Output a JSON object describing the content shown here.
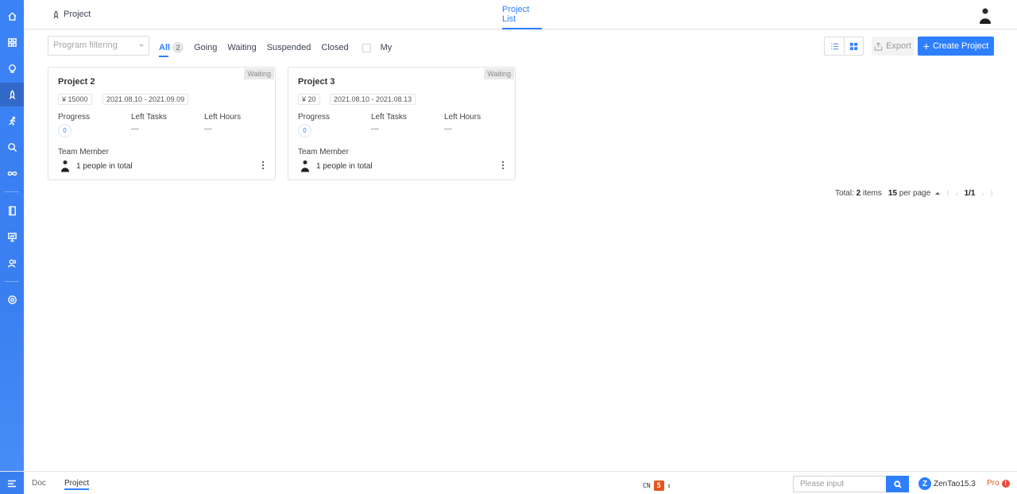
{
  "header": {
    "app_name": "Project",
    "active_tab": "Project List"
  },
  "toolbar": {
    "filter_placeholder": "Program filtering",
    "tabs": [
      {
        "label": "All",
        "count": "2"
      },
      {
        "label": "Going"
      },
      {
        "label": "Waiting"
      },
      {
        "label": "Suspended"
      },
      {
        "label": "Closed"
      }
    ],
    "my_label": "My",
    "export_label": "Export",
    "create_label": "Create Project"
  },
  "cards": [
    {
      "status": "Waiting",
      "title": "Project 2",
      "budget": "¥ 15000",
      "date_range": "2021.08.10 - 2021.09.09",
      "progress_label": "Progress",
      "progress_value": "0",
      "left_tasks_label": "Left Tasks",
      "left_tasks_value": "—",
      "left_hours_label": "Left Hours",
      "left_hours_value": "—",
      "team_label": "Team Member",
      "team_count": "1 people in total"
    },
    {
      "status": "Waiting",
      "title": "Project 3",
      "budget": "¥ 20",
      "date_range": "2021.08.10 - 2021.08.13",
      "progress_label": "Progress",
      "progress_value": "0",
      "left_tasks_label": "Left Tasks",
      "left_tasks_value": "—",
      "left_hours_label": "Left Hours",
      "left_hours_value": "—",
      "team_label": "Team Member",
      "team_count": "1 people in total"
    }
  ],
  "pager": {
    "total_prefix": "Total:",
    "total_count": "2",
    "total_suffix": "items",
    "per_page_count": "15",
    "per_page_label": "per page",
    "page": "1/1"
  },
  "footer": {
    "tabs": [
      "Doc",
      "Project"
    ],
    "lang": "CN",
    "search_placeholder": "Please input",
    "brand": "ZenTao15.3",
    "edition": "Pro"
  },
  "colors": {
    "primary": "#2e7fff",
    "rail": "#3b82f6",
    "badge_bg": "#e9e9e9",
    "pro": "#e8541e"
  },
  "icons": {
    "rail": [
      "home-icon",
      "grid-icon",
      "lightbulb-icon",
      "rocket-icon",
      "runner-icon",
      "search-icon",
      "infinity-icon",
      "book-icon",
      "presentation-icon",
      "users-icon",
      "gear-icon"
    ]
  }
}
